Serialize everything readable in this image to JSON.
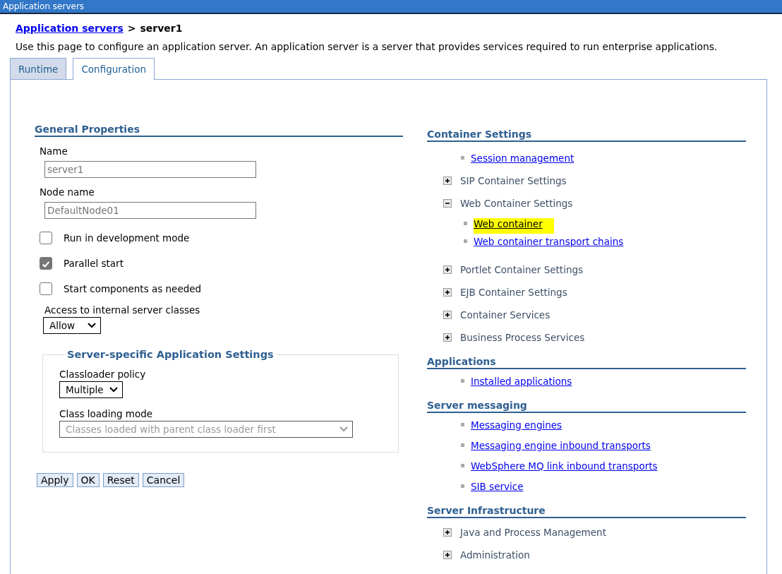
{
  "window": {
    "title": "Application servers"
  },
  "breadcrumb": {
    "link": "Application servers",
    "separator": ">",
    "current": "server1"
  },
  "description": "Use this page to configure an application server. An application server is a server that provides services required to run enterprise applications.",
  "tabs": [
    {
      "label": "Runtime",
      "selected": false
    },
    {
      "label": "Configuration",
      "selected": true
    }
  ],
  "general_properties": {
    "title": "General Properties",
    "fields": [
      {
        "label": "Name",
        "value": "server1",
        "disabled": true
      },
      {
        "label": "Node name",
        "value": "DefaultNode01",
        "disabled": true
      }
    ],
    "checkboxes": [
      {
        "label": "Run in development mode",
        "checked": false
      },
      {
        "label": "Parallel start",
        "checked": true
      },
      {
        "label": "Start components as needed",
        "checked": false
      }
    ],
    "access": {
      "label": "Access to internal server classes",
      "value": "Allow"
    },
    "app_settings": {
      "title": "Server-specific Application Settings",
      "selects": [
        {
          "label": "Classloader policy",
          "value": "Multiple",
          "disabled": false
        },
        {
          "label": "Class loading mode",
          "value": "Classes loaded with parent class loader first",
          "disabled": true
        }
      ]
    },
    "buttons": [
      "Apply",
      "OK",
      "Reset",
      "Cancel"
    ]
  },
  "sections": [
    {
      "title": "Container Settings",
      "items": [
        {
          "kind": "link",
          "label": "Session management",
          "highlighted": false
        },
        {
          "kind": "group",
          "label": "SIP Container Settings",
          "expanded": false
        },
        {
          "kind": "group",
          "label": "Web Container Settings",
          "expanded": true,
          "children": [
            {
              "label": "Web container",
              "highlighted": true
            },
            {
              "label": "Web container transport chains",
              "highlighted": false
            }
          ]
        },
        {
          "kind": "group",
          "label": "Portlet Container Settings",
          "expanded": false
        },
        {
          "kind": "group",
          "label": "EJB Container Settings",
          "expanded": false
        },
        {
          "kind": "group",
          "label": "Container Services",
          "expanded": false
        },
        {
          "kind": "group",
          "label": "Business Process Services",
          "expanded": false
        }
      ]
    },
    {
      "title": "Applications",
      "items": [
        {
          "kind": "link",
          "label": "Installed applications",
          "highlighted": false
        }
      ]
    },
    {
      "title": "Server messaging",
      "items": [
        {
          "kind": "link",
          "label": "Messaging engines",
          "highlighted": false
        },
        {
          "kind": "link",
          "label": "Messaging engine inbound transports",
          "highlighted": false
        },
        {
          "kind": "link",
          "label": "WebSphere MQ link inbound transports",
          "highlighted": false
        },
        {
          "kind": "link",
          "label": "SIB service",
          "highlighted": false
        }
      ]
    },
    {
      "title": "Server Infrastructure",
      "items": [
        {
          "kind": "group",
          "label": "Java and Process Management",
          "expanded": false
        },
        {
          "kind": "group",
          "label": "Administration",
          "expanded": false
        }
      ]
    }
  ]
}
